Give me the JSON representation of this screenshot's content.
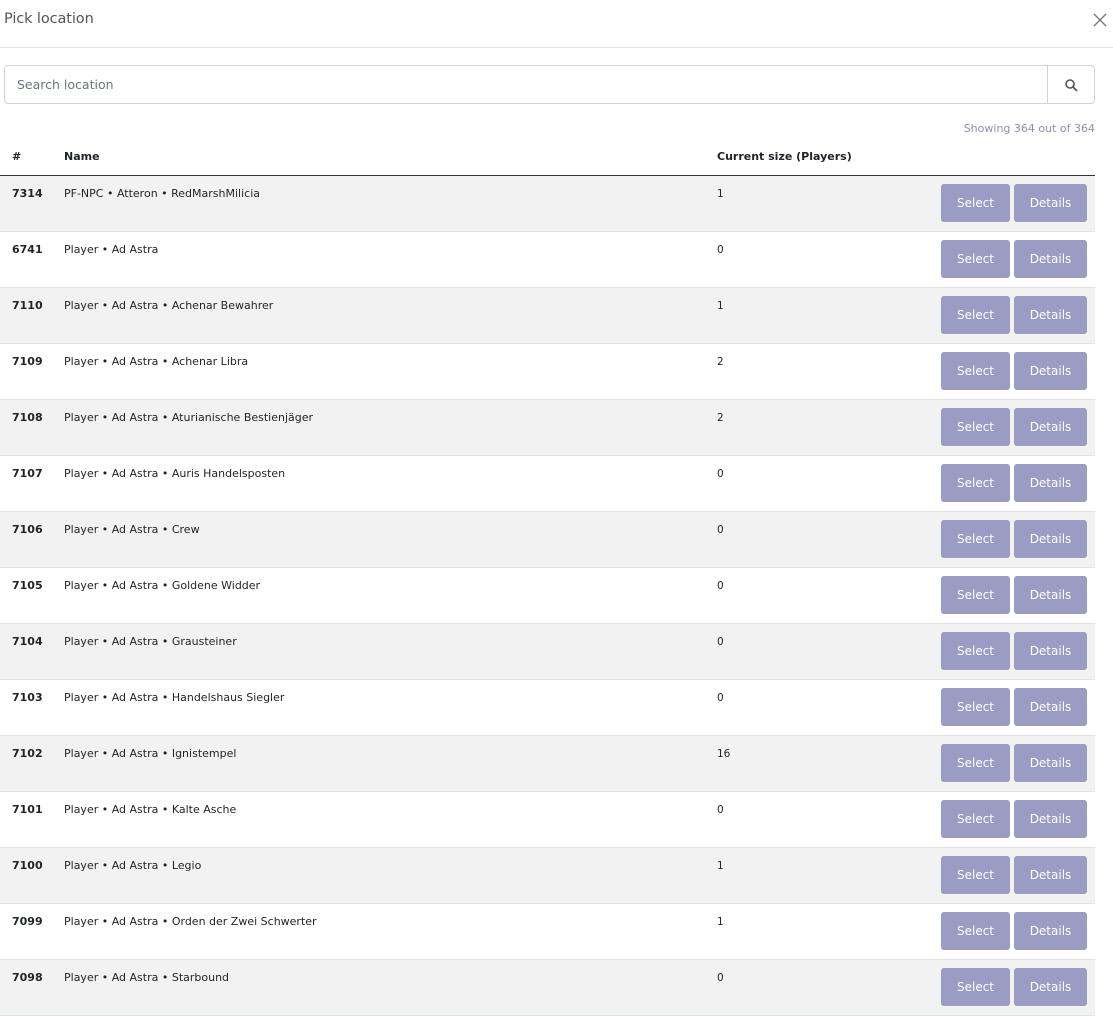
{
  "modal": {
    "title": "Pick location"
  },
  "search": {
    "placeholder": "Search location",
    "value": ""
  },
  "count_text": "Showing 364 out of 364",
  "table": {
    "headers": {
      "id": "#",
      "name": "Name",
      "size": "Current size (Players)"
    },
    "select_label": "Select",
    "details_label": "Details",
    "rows": [
      {
        "id": "7314",
        "name": "PF-NPC • Atteron • RedMarshMilicia",
        "size": "1"
      },
      {
        "id": "6741",
        "name": "Player • Ad Astra",
        "size": "0"
      },
      {
        "id": "7110",
        "name": "Player • Ad Astra • Achenar Bewahrer",
        "size": "1"
      },
      {
        "id": "7109",
        "name": "Player • Ad Astra • Achenar Libra",
        "size": "2"
      },
      {
        "id": "7108",
        "name": "Player • Ad Astra • Aturianische Bestienjäger",
        "size": "2"
      },
      {
        "id": "7107",
        "name": "Player • Ad Astra • Auris Handelsposten",
        "size": "0"
      },
      {
        "id": "7106",
        "name": "Player • Ad Astra • Crew",
        "size": "0"
      },
      {
        "id": "7105",
        "name": "Player • Ad Astra • Goldene Widder",
        "size": "0"
      },
      {
        "id": "7104",
        "name": "Player • Ad Astra • Grausteiner",
        "size": "0"
      },
      {
        "id": "7103",
        "name": "Player • Ad Astra • Handelshaus Siegler",
        "size": "0"
      },
      {
        "id": "7102",
        "name": "Player • Ad Astra • Ignistempel",
        "size": "16"
      },
      {
        "id": "7101",
        "name": "Player • Ad Astra • Kalte Asche",
        "size": "0"
      },
      {
        "id": "7100",
        "name": "Player • Ad Astra • Legio",
        "size": "1"
      },
      {
        "id": "7099",
        "name": "Player • Ad Astra • Orden der Zwei Schwerter",
        "size": "1"
      },
      {
        "id": "7098",
        "name": "Player • Ad Astra • Starbound",
        "size": "0"
      }
    ]
  },
  "colors": {
    "button_bg": "#9a9cc4",
    "stripe_bg": "#f2f2f2",
    "count_text": "#8a8fb0"
  },
  "icons": {
    "close": "close-icon",
    "search": "search-icon"
  }
}
